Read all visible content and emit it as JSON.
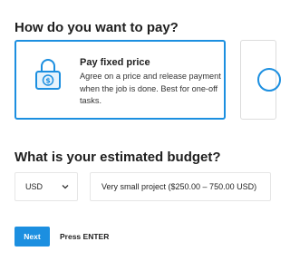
{
  "payment": {
    "heading": "How do you want to pay?",
    "fixed_price": {
      "title": "Pay fixed price",
      "description": "Agree on a price and release payment when the job is done. Best for one-off tasks.",
      "icon": "lock-dollar-icon",
      "selected": true
    }
  },
  "budget": {
    "heading": "What is your estimated budget?",
    "currency_value": "USD",
    "range_value": "Very small project ($250.00 – 750.00 USD)"
  },
  "footer": {
    "next_label": "Next",
    "hint": "Press ENTER"
  },
  "colors": {
    "accent": "#1c8fe0",
    "border": "#e6e6e6",
    "text": "#1f1f1f"
  }
}
